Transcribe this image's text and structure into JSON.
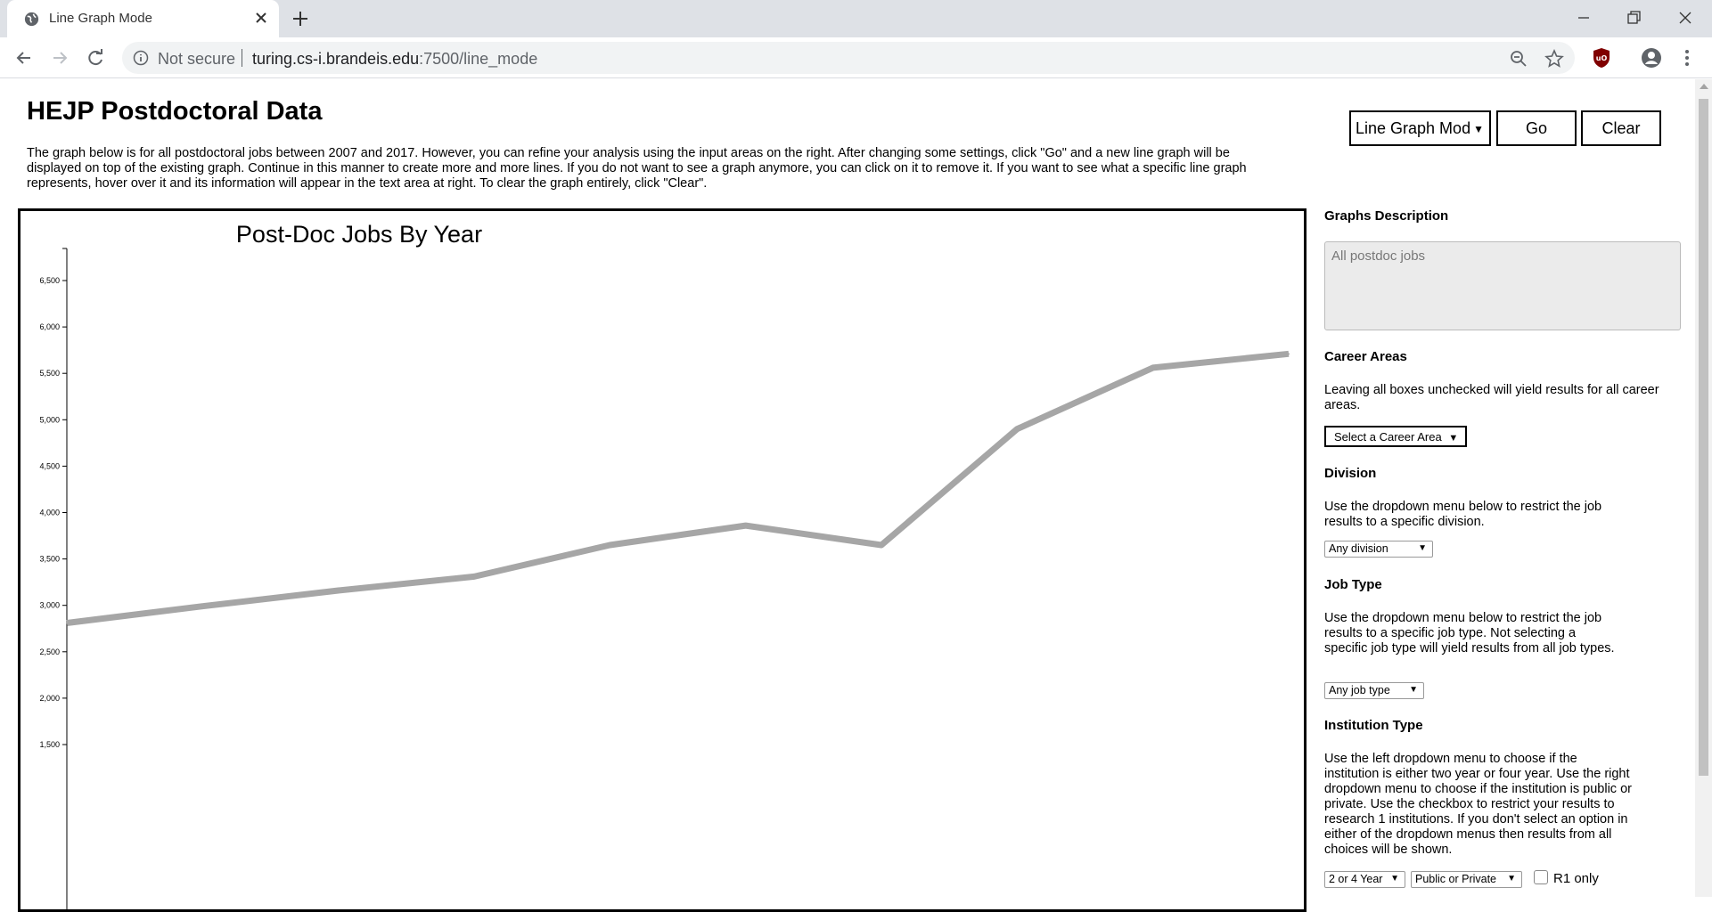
{
  "browser": {
    "tab_title": "Line Graph Mode",
    "security_label": "Not secure",
    "url_host": "turing.cs-i.brandeis.edu",
    "url_path": ":7500/line_mode"
  },
  "header": {
    "title": "HEJP Postdoctoral Data",
    "intro": "The graph below is for all postdoctoral jobs between 2007 and 2017. However, you can refine your analysis using the input areas on the right. After changing some settings, click \"Go\" and a new line graph will be displayed on top of the existing graph. Continue in this manner to create more and more lines. If you do not want to see a graph anymore, you can click on it to remove it. If you want to see what a specific line graph represents, hover over it and its information will appear in the text area at right. To clear the graph entirely, click \"Clear\"."
  },
  "controls": {
    "mode_select": "Line Graph Mod",
    "go_label": "Go",
    "clear_label": "Clear"
  },
  "sidebar": {
    "graphs_heading": "Graphs Description",
    "graphs_description": "All postdoc jobs",
    "career_heading": "Career Areas",
    "career_text": "Leaving all boxes unchecked will yield results for all career areas.",
    "career_button": "Select a Career Area",
    "division_heading": "Division",
    "division_text": "Use the dropdown menu below to restrict the job results to a specific division.",
    "division_select": "Any division",
    "jobtype_heading": "Job Type",
    "jobtype_text": "Use the dropdown menu below to restrict the job results to a specific job type. Not selecting a specific job type will yield results from all job types.",
    "jobtype_select": "Any job type",
    "institution_heading": "Institution Type",
    "institution_text": "Use the left dropdown menu to choose if the institution is either two year or four year. Use the right dropdown menu to choose if the institution is public or private. Use the checkbox to restrict your results to research 1 institutions. If you don't select an option in either of the dropdown menus then results from all choices will be shown.",
    "year_select": "2 or 4 Year",
    "public_select": "Public or Private",
    "r1_label": "R1 only"
  },
  "chart_data": {
    "type": "line",
    "title": "Post-Doc Jobs By Year",
    "y_ticks": [
      "6,500",
      "6,000",
      "5,500",
      "5,000",
      "4,500",
      "4,000",
      "3,500",
      "3,000",
      "2,500",
      "2,000",
      "1,500"
    ],
    "series": [
      {
        "values": [
          2810,
          2990,
          3160,
          3310,
          3650,
          3860,
          3650,
          4900,
          5560,
          5710
        ]
      }
    ],
    "line_color": "#a6a6a6"
  }
}
